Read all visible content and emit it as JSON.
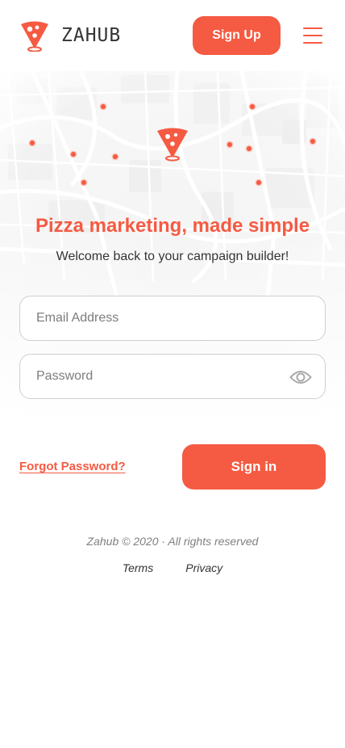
{
  "app": {
    "brand": "ZAHUB",
    "accent_color": "#f55a42"
  },
  "header": {
    "logo_icon": "pizza-pin-icon",
    "signup_label": "Sign Up",
    "menu_icon": "hamburger-menu-icon"
  },
  "hero": {
    "title": "Pizza marketing, made simple",
    "subtitle": "Welcome back to your campaign builder!",
    "map_marker_icon": "pizza-pin-icon"
  },
  "form": {
    "email": {
      "placeholder": "Email Address",
      "value": ""
    },
    "password": {
      "placeholder": "Password",
      "value": "",
      "toggle_icon": "eye-icon"
    },
    "forgot_label": "Forgot Password?",
    "signin_label": "Sign in"
  },
  "footer": {
    "copyright": "Zahub © 2020 · All rights reserved",
    "links": [
      "Terms",
      "Privacy"
    ]
  }
}
